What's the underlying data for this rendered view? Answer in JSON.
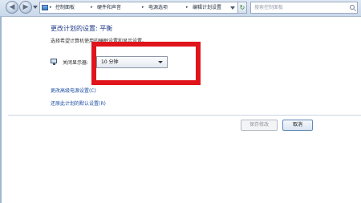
{
  "address_bar": {
    "breadcrumbs": [
      "控制面板",
      "硬件和声音",
      "电源选项",
      "编辑计划设置"
    ],
    "search_placeholder": "搜索控制面板"
  },
  "page": {
    "title": "更改计划的设置: 平衡",
    "subtitle": "选择希望计算机使用的睡眠设置和显示设置。"
  },
  "display_setting": {
    "label": "关闭显示器:",
    "selected_value": "10 分钟"
  },
  "links": {
    "advanced": "更改高级电源设置(C)",
    "restore": "还原此计划的默认设置(R)"
  },
  "buttons": {
    "save": "保存修改",
    "cancel": "取消"
  },
  "annotation": {
    "highlight_color": "#e0141b"
  }
}
